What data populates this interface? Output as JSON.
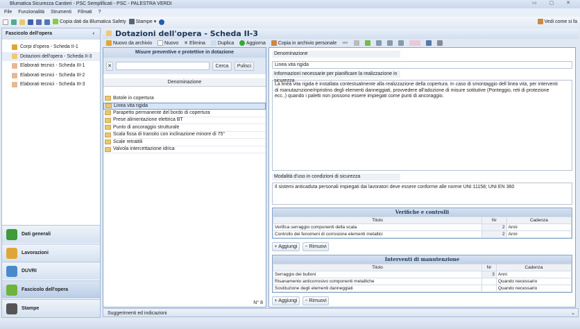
{
  "window": {
    "title": "Blumatica Sicurezza Cantieri - PSC Semplificati - PSC - PALESTRA VERDI",
    "controls": "▭ ▢ ✕"
  },
  "menu": [
    "File",
    "Funzionalità",
    "Strumenti",
    "Filmati",
    "?"
  ],
  "toolbar": {
    "copy": "Copia dati da Blumatica Safety",
    "print": "Stampe",
    "help_right": "Vedi come si fa"
  },
  "sidebar": {
    "title": "Fascicolo dell'opera",
    "collapse": "‹",
    "items": [
      "Corpi d'opera - Scheda II-1",
      "Dotazioni dell'opera - Scheda II-3",
      "Elaborati tecnici - Scheda III-1",
      "Elaborati tecnici - Scheda III-2",
      "Elaborati tecnici - Scheda III-3"
    ],
    "nav": [
      {
        "label": "Dati generali",
        "color": "#3f9a3a"
      },
      {
        "label": "Lavorazioni",
        "color": "#e0a53a"
      },
      {
        "label": "DUVRI",
        "color": "#4b8ac9"
      },
      {
        "label": "Fascicolo dell'opera",
        "color": "#6fb33f"
      },
      {
        "label": "Stampe",
        "color": "#555555"
      }
    ]
  },
  "main": {
    "title": "Dotazioni dell'opera - Scheda II-3",
    "toolbar": [
      "Nuovo da archivio",
      "Nuovo",
      "Elimina",
      "Duplica",
      "Aggiorna",
      "Copia in archivio personale"
    ],
    "list": {
      "title": "Misure preventive e protettive in dotazione",
      "search_value": "",
      "search_button": "Cerca",
      "clear_button": "Pulisci",
      "column": "Denominazione",
      "items": [
        "Botole in copertura",
        "Linea vita rigida",
        "Parapetto permanente del bordo di copertura",
        "Prese alimentazione elettrica BT",
        "Punto di ancoraggio strutturale",
        "Scala fissa di transito con inclinazione minore di 75°",
        "Scale retrattili",
        "Valvola intercettazione idrica"
      ],
      "count": "N° 8"
    },
    "detail": {
      "name_label": "Denominazione",
      "name_value": "Linea vita rigida",
      "info_label": "Informazioni necessarie per pianificare la realizzazione in sicurezza",
      "info_value": "La linea vita rigida è installata contestualmente alla realizzazione della copertura. In caso di smontaggio dell linea vita, per interventi di manutaznzione/ripristino degli elementi danneggiati, provvedere all'adozione di misure sotitutive (Ponteggio, reti di protezione ecc..) quando i paletti non possono essere impiegati come punti di ancoraggio.",
      "use_label": "Modalità d'uso in condizioni di sicurezza",
      "use_value": "Il sistemi anticaduta personali  impiegati dai lavoratori  deve essere conforme alle norme UNI 11158; UNI EN 360",
      "checks": {
        "title": "Verifiche e controlli",
        "columns": [
          "Titolo",
          "Nr",
          "Cadenza"
        ],
        "rows": [
          {
            "t": "Verifica serraggio componenti della scala",
            "n": "2",
            "c": "Anni"
          },
          {
            "t": "Controllo dei fenomeni di corrosione elementi metallici",
            "n": "2",
            "c": "Anni"
          }
        ]
      },
      "maint": {
        "title": "Interventi di manutenzione",
        "columns": [
          "Titolo",
          "Nr",
          "Cadenza"
        ],
        "rows": [
          {
            "t": "Serraggio dei bulloni",
            "n": "3",
            "c": "Anni"
          },
          {
            "t": "Risanamento anticorrosivo componenti metalliche",
            "n": "",
            "c": "Quando necessario"
          },
          {
            "t": "Sostituzione degli elementi danneggiati",
            "n": "",
            "c": "Quando necessario"
          }
        ]
      },
      "add": "Aggiungi",
      "remove": "Rimuovi"
    }
  },
  "footer": {
    "hints": "Suggerimenti ed indicazioni"
  }
}
